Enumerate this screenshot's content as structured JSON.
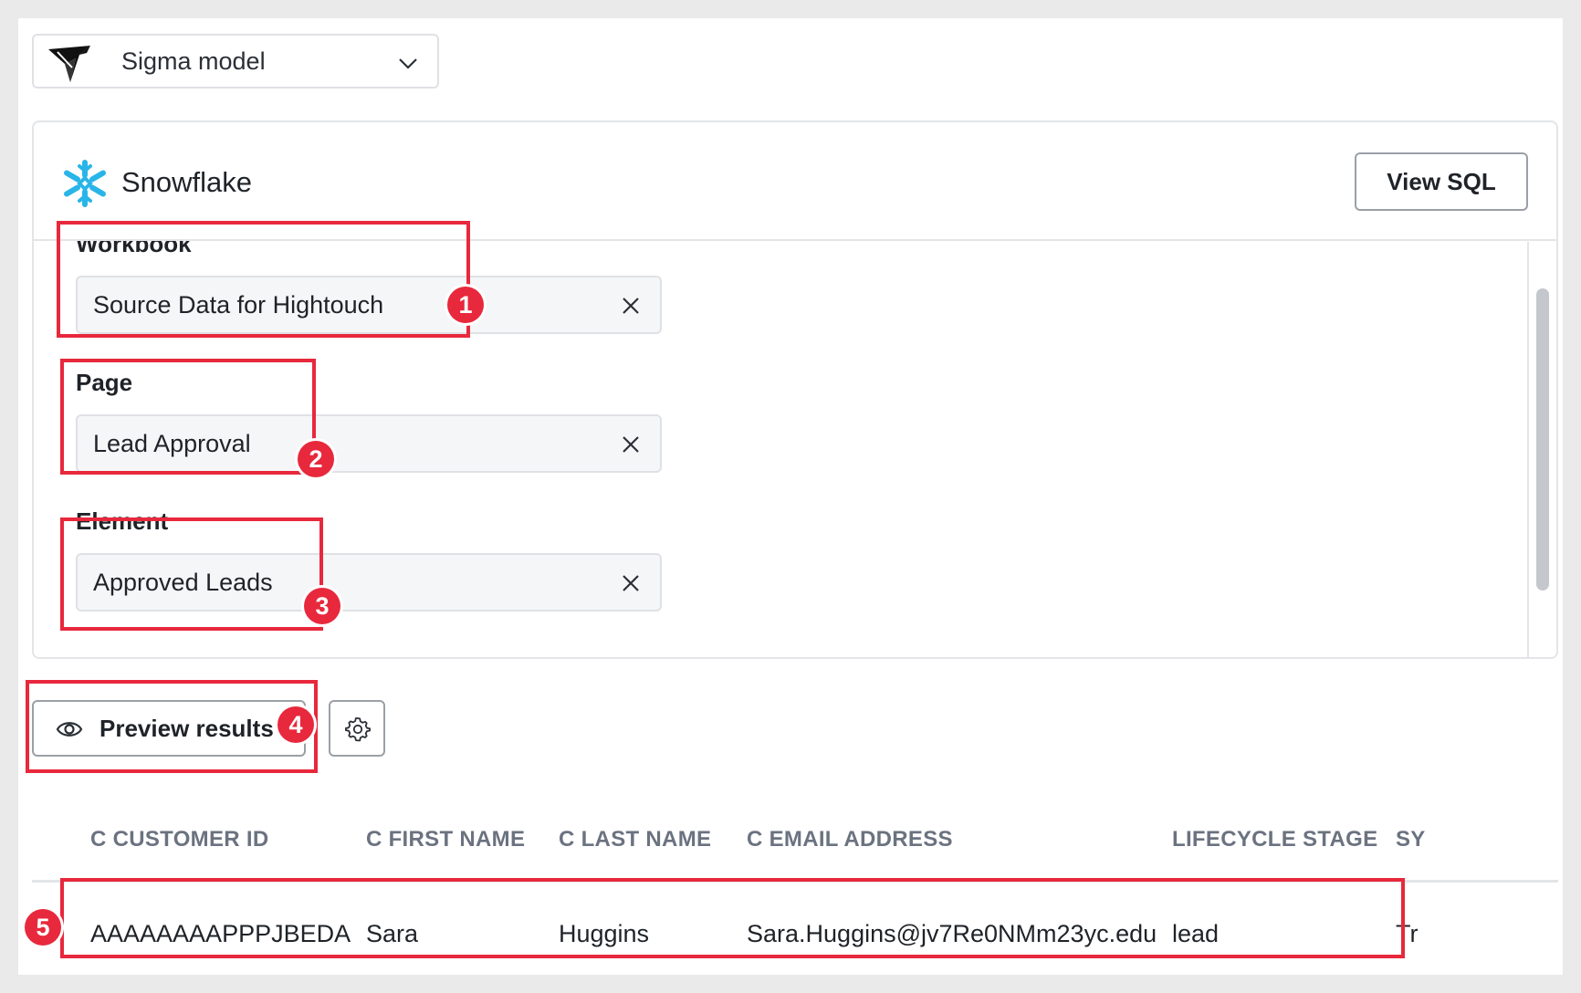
{
  "model_select": {
    "label": "Sigma model",
    "icon": "sigma-logo-icon"
  },
  "source": {
    "name": "Snowflake",
    "icon": "snowflake-icon",
    "view_sql_label": "View SQL",
    "workbook": {
      "label": "Workbook",
      "value": "Source Data for Hightouch"
    },
    "page": {
      "label": "Page",
      "value": "Lead Approval"
    },
    "element": {
      "label": "Element",
      "value": "Approved Leads"
    }
  },
  "preview": {
    "label": "Preview results",
    "icon": "eye-icon",
    "settings_icon": "gear-icon"
  },
  "table": {
    "columns": [
      "C CUSTOMER ID",
      "C FIRST NAME",
      "C LAST NAME",
      "C EMAIL ADDRESS",
      "LIFECYCLE STAGE",
      "SY"
    ],
    "rows": [
      [
        "AAAAAAAAPPPJBEDA",
        "Sara",
        "Huggins",
        "Sara.Huggins@jv7Re0NMm23yc.edu",
        "lead",
        "Tr"
      ]
    ]
  },
  "annotations": [
    "1",
    "2",
    "3",
    "4",
    "5"
  ],
  "colors": {
    "highlight": "#e8283c",
    "snowflake": "#29b5e8"
  }
}
